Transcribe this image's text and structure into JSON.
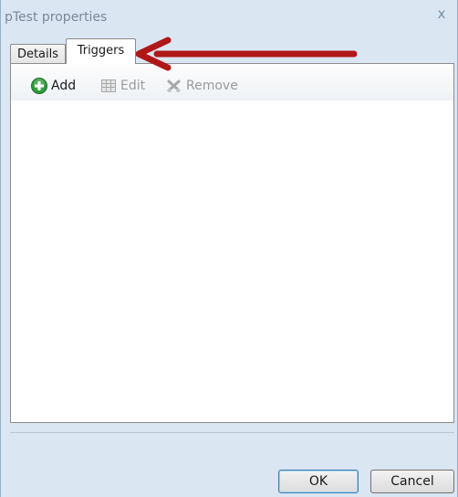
{
  "window": {
    "title": "pTest properties",
    "close_glyph": "x"
  },
  "tabs": [
    {
      "label": "Details",
      "active": false
    },
    {
      "label": "Triggers",
      "active": true
    }
  ],
  "toolbar": {
    "add_label": "Add",
    "edit_label": "Edit",
    "remove_label": "Remove",
    "add_icon": "add-icon",
    "edit_icon": "edit-icon",
    "remove_icon": "remove-icon"
  },
  "buttons": {
    "ok_label": "OK",
    "cancel_label": "Cancel"
  },
  "annotation": {
    "color": "#b01818"
  },
  "colors": {
    "accent": "#3c7fb1",
    "add_green": "#2e9a3a"
  }
}
